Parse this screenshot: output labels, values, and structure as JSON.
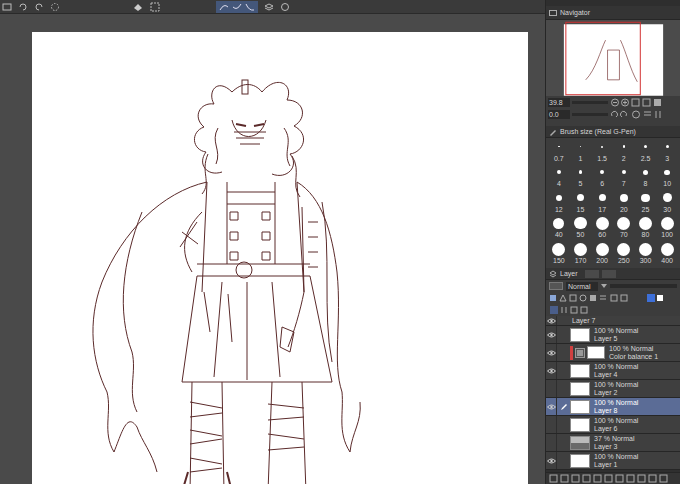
{
  "navigator": {
    "title": "Navigator",
    "zoom": "39.8",
    "rotation": "0.0"
  },
  "brush_size": {
    "title": "Brush size (Real G-Pen)",
    "sizes": [
      "0.7",
      "1",
      "1.5",
      "2",
      "2.5",
      "3",
      "4",
      "5",
      "6",
      "7",
      "8",
      "10",
      "12",
      "15",
      "17",
      "20",
      "25",
      "30",
      "40",
      "50",
      "60",
      "70",
      "80",
      "100",
      "150",
      "170",
      "200",
      "250",
      "300",
      "400"
    ]
  },
  "layer_panel": {
    "title": "Layer",
    "blend_mode": "Normal",
    "layers": [
      {
        "name": "Layer 7",
        "visible": true,
        "selected": false,
        "kind": "raster"
      },
      {
        "mode": "100 % Normal",
        "name": "Layer 5",
        "visible": true,
        "selected": false,
        "kind": "raster"
      },
      {
        "mode": "100 % Normal",
        "name": "Color balance 1",
        "visible": true,
        "selected": false,
        "kind": "correction"
      },
      {
        "mode": "100 % Normal",
        "name": "Layer 4",
        "visible": true,
        "selected": false,
        "kind": "raster"
      },
      {
        "mode": "100 % Normal",
        "name": "Layer 2",
        "visible": false,
        "selected": false,
        "kind": "raster"
      },
      {
        "mode": "100 % Normal",
        "name": "Layer 8",
        "visible": true,
        "selected": true,
        "kind": "raster"
      },
      {
        "mode": "100 % Normal",
        "name": "Layer 6",
        "visible": false,
        "selected": false,
        "kind": "raster"
      },
      {
        "mode": "37 % Normal",
        "name": "Layer 3",
        "visible": false,
        "selected": false,
        "kind": "image"
      },
      {
        "mode": "100 % Normal",
        "name": "Layer 1",
        "visible": true,
        "selected": false,
        "kind": "raster"
      }
    ]
  }
}
